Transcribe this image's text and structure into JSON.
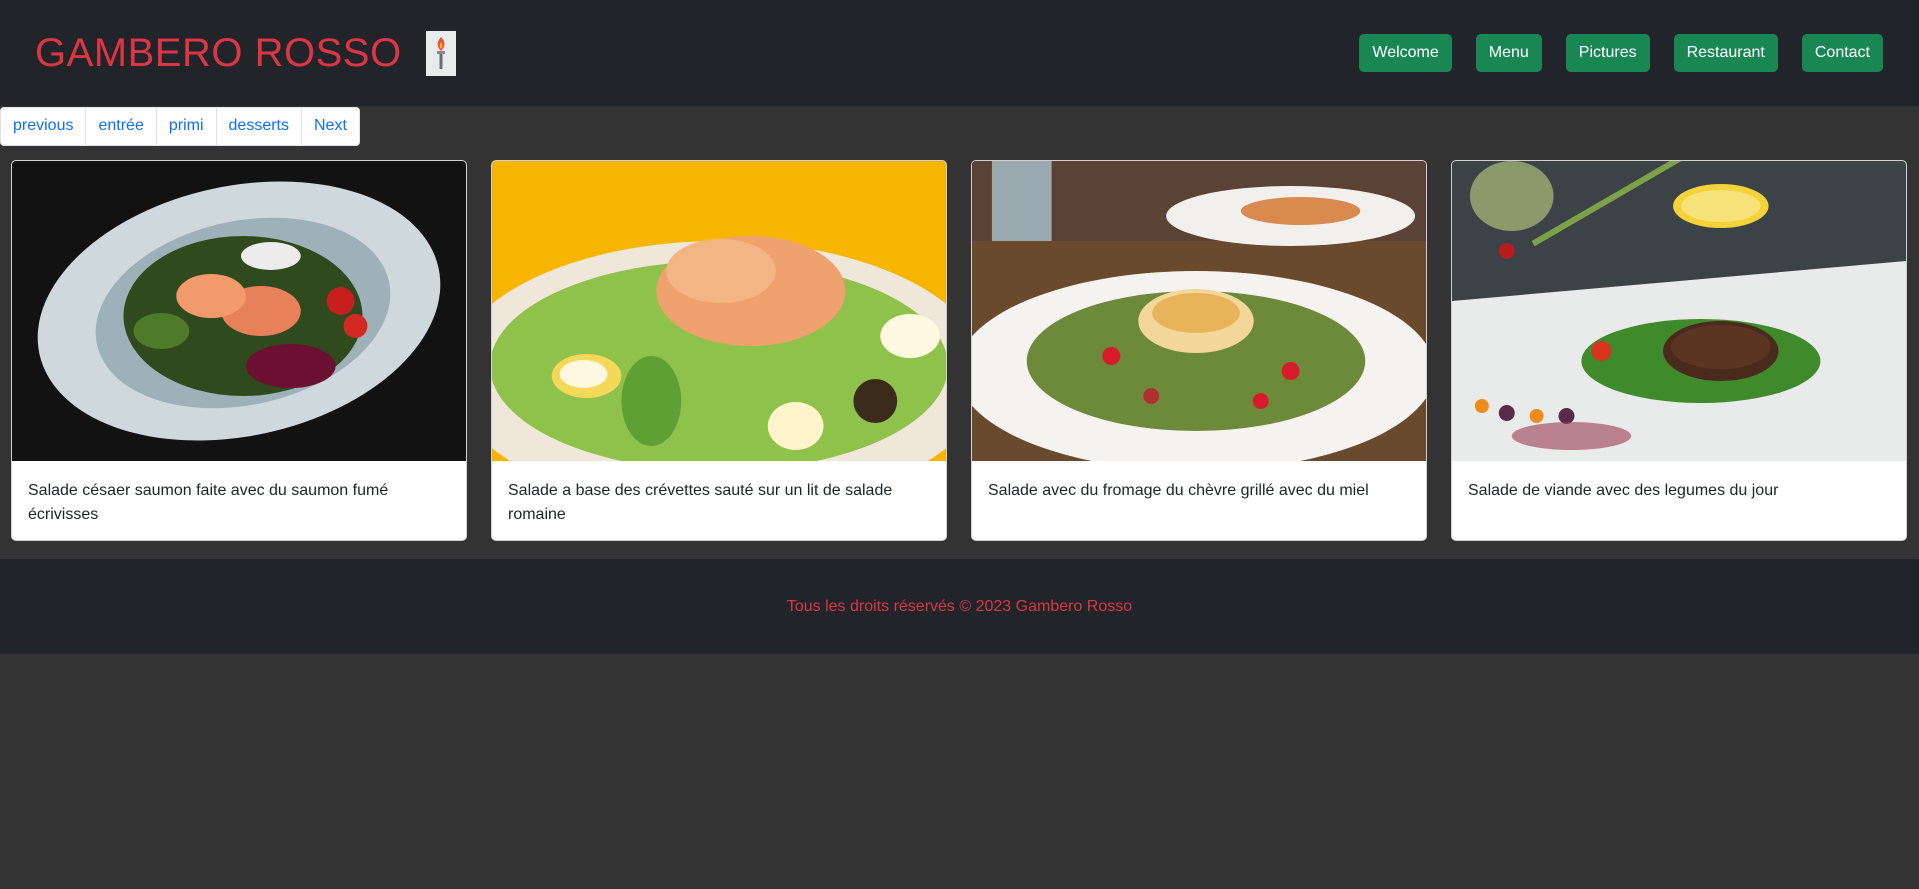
{
  "header": {
    "brand": "GAMBERO ROSSO",
    "logo_icon": "torch-icon",
    "nav": [
      {
        "label": "Welcome"
      },
      {
        "label": "Menu"
      },
      {
        "label": "Pictures"
      },
      {
        "label": "Restaurant"
      },
      {
        "label": "Contact"
      }
    ]
  },
  "pagination": {
    "items": [
      {
        "label": "previous"
      },
      {
        "label": "entrée"
      },
      {
        "label": "primi"
      },
      {
        "label": "desserts"
      },
      {
        "label": "Next"
      }
    ]
  },
  "cards": [
    {
      "text": "Salade césaer saumon faite avec du saumon fumé écrivisses"
    },
    {
      "text": "Salade a base des crévettes sauté sur un lit de salade romaine"
    },
    {
      "text": "Salade avec du fromage du chèvre grillé avec du miel"
    },
    {
      "text": "Salade de viande avec des legumes du jour"
    }
  ],
  "footer": {
    "text": "Tous les droits réservés © 2023 Gambero Rosso"
  },
  "colors": {
    "brand": "#dc3545",
    "nav_button": "#198754",
    "navbar": "#212529",
    "page_bg": "#333333",
    "link": "#0d6efd"
  }
}
